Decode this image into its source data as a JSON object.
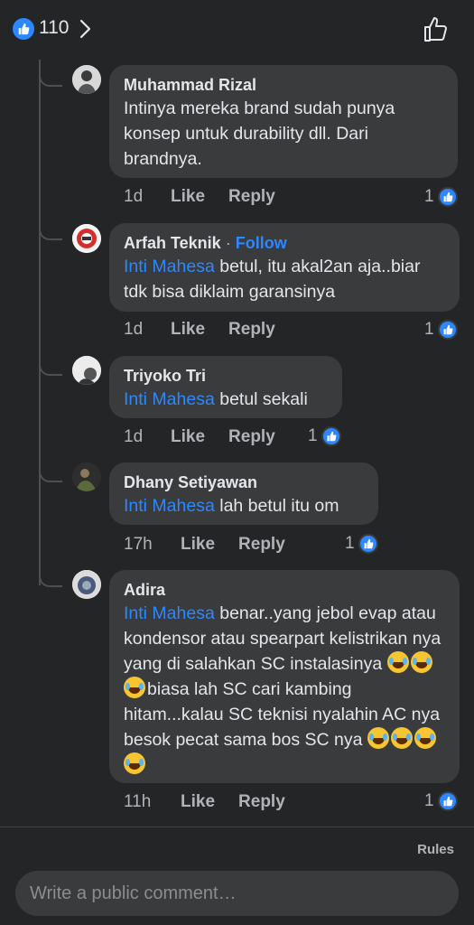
{
  "header": {
    "reaction_count": "110"
  },
  "comments": [
    {
      "author": "Muhammad Rizal",
      "follow": "",
      "mention": "",
      "text": "Intinya mereka brand sudah punya konsep untuk durability dll. Dari brandnya.",
      "time": "1d",
      "like_label": "Like",
      "reply_label": "Reply",
      "likes": "1"
    },
    {
      "author": "Arfah Teknik",
      "follow": "Follow",
      "mention": "Inti Mahesa",
      "text": "betul, itu akal2an aja..biar tdk bisa diklaim garansinya",
      "time": "1d",
      "like_label": "Like",
      "reply_label": "Reply",
      "likes": "1"
    },
    {
      "author": "Triyoko Tri",
      "follow": "",
      "mention": "Inti Mahesa",
      "text": "betul sekali",
      "time": "1d",
      "like_label": "Like",
      "reply_label": "Reply",
      "likes": "1"
    },
    {
      "author": "Dhany Setiyawan",
      "follow": "",
      "mention": "Inti Mahesa",
      "text": "lah betul itu om",
      "time": "17h",
      "like_label": "Like",
      "reply_label": "Reply",
      "likes": "1"
    },
    {
      "author": "Adira",
      "follow": "",
      "mention": "Inti Mahesa",
      "text_parts": [
        "benar..yang jebol evap atau kondensor atau spearpart kelistrikan nya yang di salahkan SC instalasinya ",
        "biasa lah SC cari kambing hitam...kalau SC teknisi nyalahin AC nya besok pecat sama bos SC nya "
      ],
      "emoji": "tears-of-joy",
      "time": "11h",
      "like_label": "Like",
      "reply_label": "Reply",
      "likes": "1"
    }
  ],
  "footer": {
    "rules_label": "Rules",
    "composer_placeholder": "Write a public comment…"
  },
  "colors": {
    "background": "#242526",
    "bubble": "#3a3b3c",
    "accent": "#2d88ff"
  }
}
